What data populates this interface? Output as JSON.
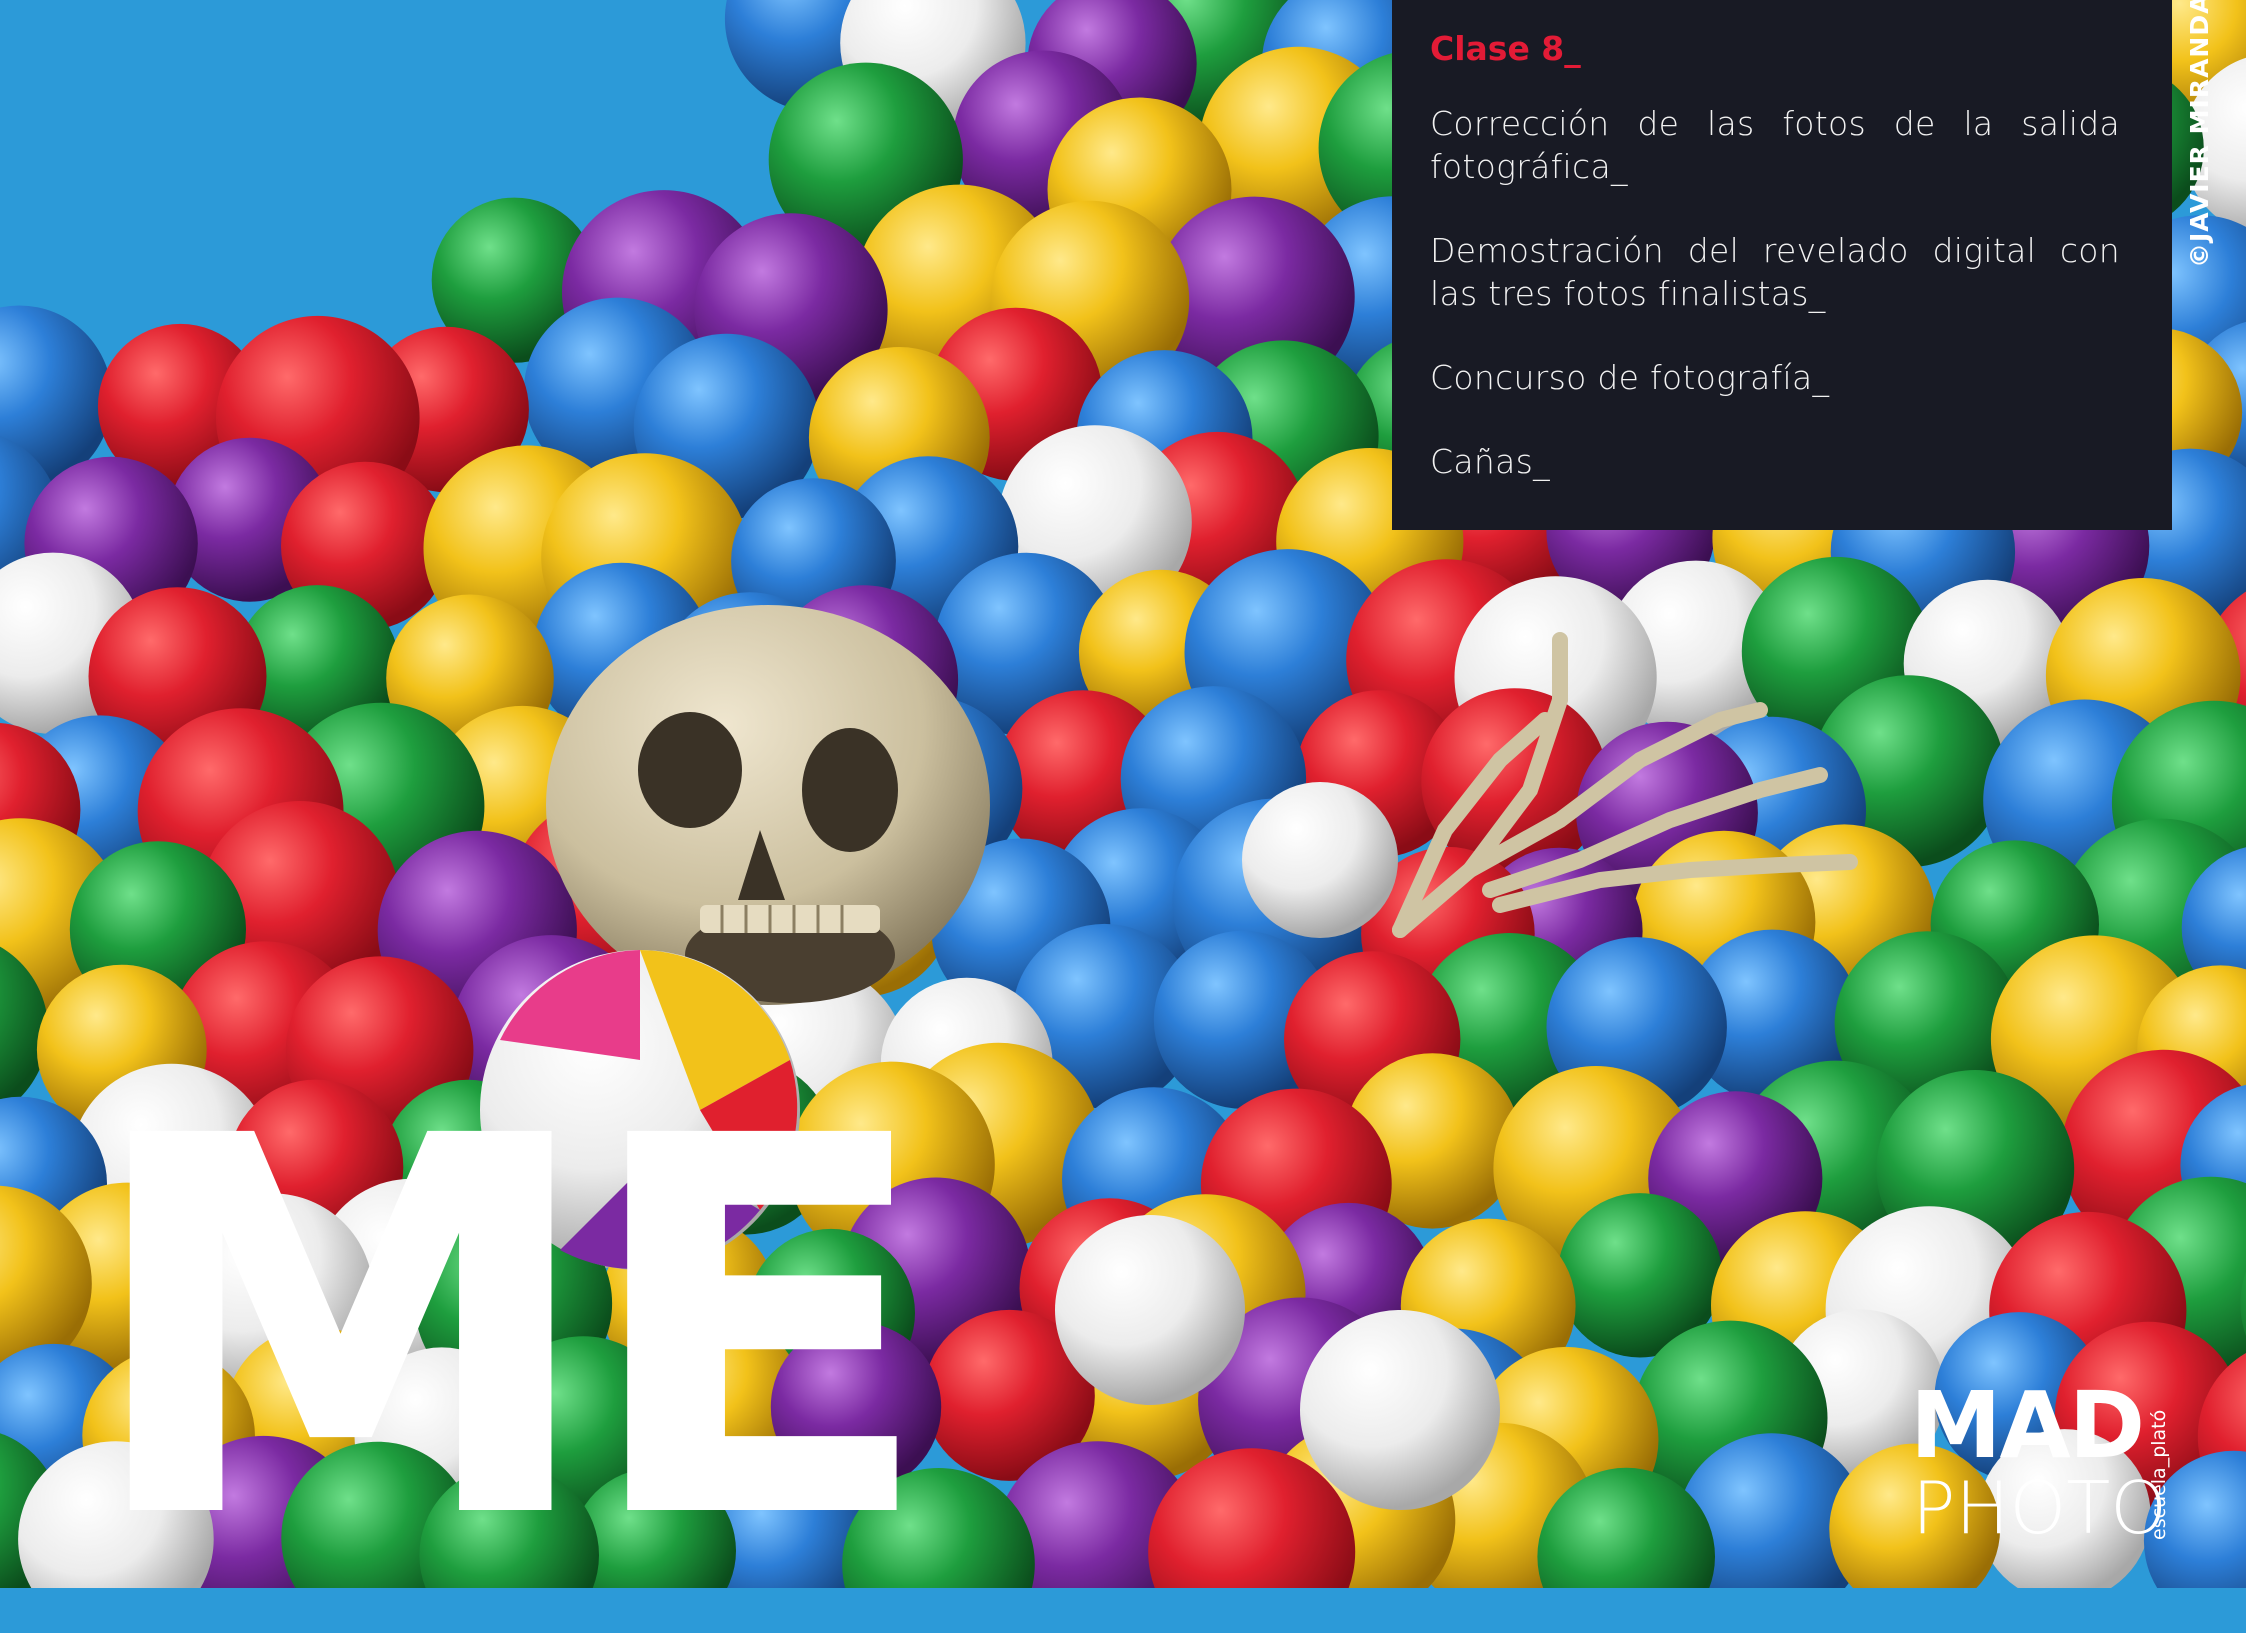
{
  "panel": {
    "heading": "Clase 8_",
    "items": [
      "Corrección de las fotos de la salida fotográfica_",
      "Demostración del revelado digital con las tres fotos finalistas_",
      "Concurso de fotografía_",
      "Cañas_"
    ]
  },
  "credit": "©JAVIER MIRANDA",
  "big_letters": "ME",
  "logo": {
    "line1": "MAD",
    "line2": "PHOTO",
    "side_text": "escuela_plató"
  },
  "colors": {
    "background_blue": "#2c9ad8",
    "panel_bg": "#181a24",
    "heading_red": "#e31b36",
    "ball_colors": [
      "#e0202e",
      "#2d7fd8",
      "#7b2aa2",
      "#1e9e3e",
      "#f2c21a",
      "#f2f2f2"
    ]
  }
}
